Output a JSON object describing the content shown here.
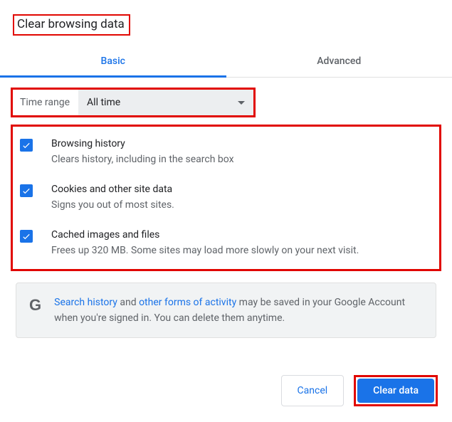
{
  "title": "Clear browsing data",
  "tabs": {
    "basic": "Basic",
    "advanced": "Advanced"
  },
  "range": {
    "label": "Time range",
    "value": "All time"
  },
  "options": [
    {
      "title": "Browsing history",
      "desc": "Clears history, including in the search box"
    },
    {
      "title": "Cookies and other site data",
      "desc": "Signs you out of most sites."
    },
    {
      "title": "Cached images and files",
      "desc": "Frees up 320 MB. Some sites may load more slowly on your next visit."
    }
  ],
  "info": {
    "link1": "Search history",
    "t1": " and ",
    "link2": "other forms of activity",
    "t2": " may be saved in your Google Account when you're signed in. You can delete them anytime."
  },
  "buttons": {
    "cancel": "Cancel",
    "clear": "Clear data"
  }
}
